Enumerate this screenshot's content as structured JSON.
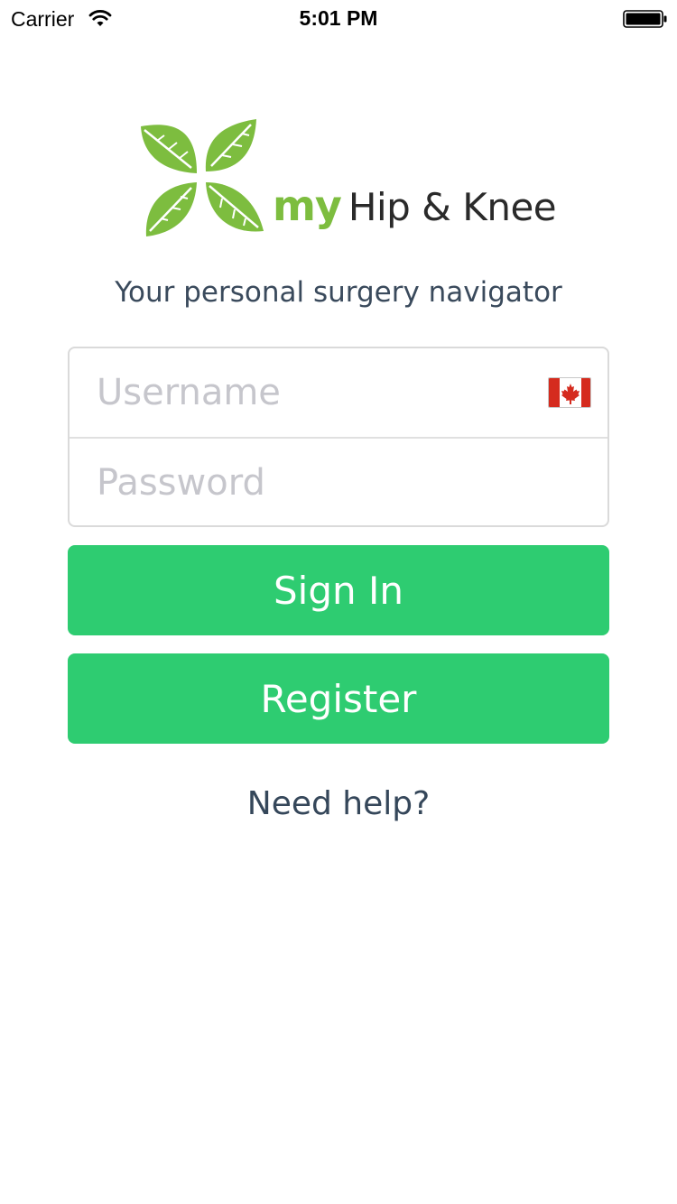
{
  "status_bar": {
    "carrier": "Carrier",
    "time": "5:01 PM",
    "wifi_icon": "wifi-icon",
    "battery_icon": "battery-full-icon"
  },
  "logo": {
    "icon": "four-leaves-icon",
    "text_my": "my",
    "text_name": "Hip & Knee",
    "colors": {
      "leaf": "#7dbd3f",
      "name": "#2a2a2a"
    }
  },
  "tagline": "Your personal surgery navigator",
  "form": {
    "username_placeholder": "Username",
    "username_value": "",
    "password_placeholder": "Password",
    "password_value": "",
    "country_flag_icon": "canada-flag-icon"
  },
  "buttons": {
    "sign_in": "Sign In",
    "register": "Register",
    "color": "#2ecc71"
  },
  "help_link": "Need help?"
}
